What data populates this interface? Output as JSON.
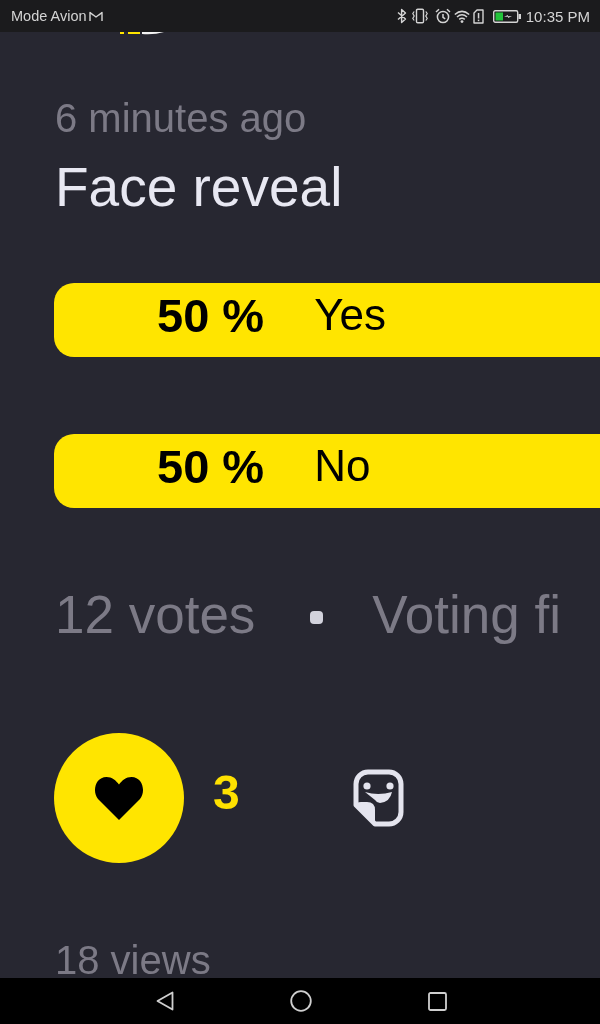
{
  "status_bar": {
    "mode_text": "Mode Avion",
    "time": "10:35 PM"
  },
  "post": {
    "timestamp": "6 minutes ago",
    "title": "Face reveal"
  },
  "poll": {
    "options": [
      {
        "percent": "50 %",
        "label": "Yes"
      },
      {
        "percent": "50 %",
        "label": "No"
      }
    ],
    "votes": "12 votes",
    "status": "Voting fi"
  },
  "reactions": {
    "liked": true,
    "like_count": "3"
  },
  "views": "18 views"
}
